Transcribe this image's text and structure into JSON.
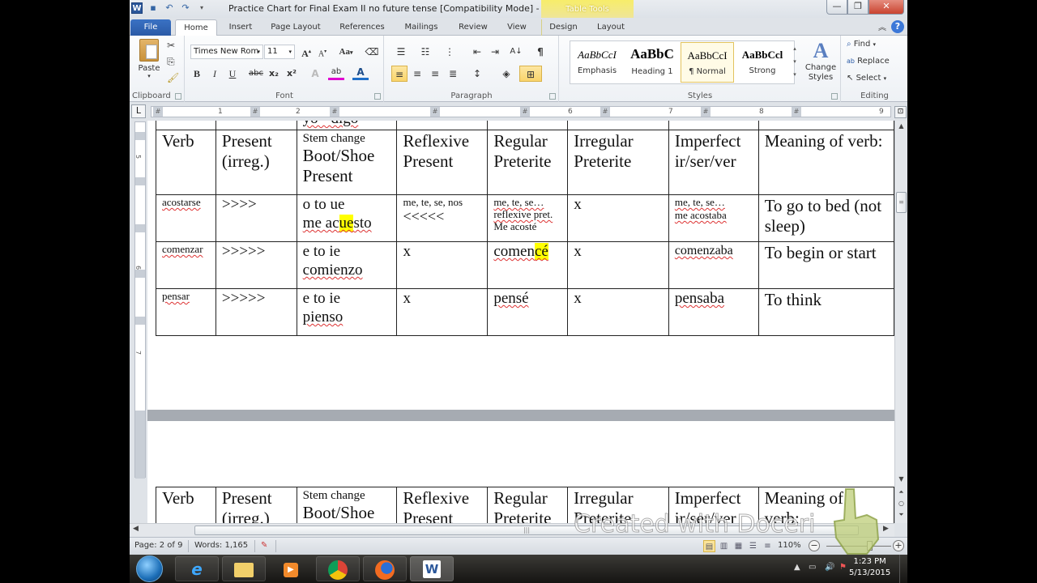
{
  "window": {
    "title": "Practice Chart for Final Exam II no future tense [Compatibility Mode]  -  Mi...",
    "contextual_tab_group": "Table Tools",
    "buttons": {
      "minimize": "—",
      "restore": "❐",
      "close": "✕"
    }
  },
  "quick_access": {
    "app_icon": "W",
    "save": "save-icon",
    "undo": "undo-icon",
    "redo": "redo-icon"
  },
  "tabs": [
    {
      "label": "File"
    },
    {
      "label": "Home",
      "active": true
    },
    {
      "label": "Insert"
    },
    {
      "label": "Page Layout"
    },
    {
      "label": "References"
    },
    {
      "label": "Mailings"
    },
    {
      "label": "Review"
    },
    {
      "label": "View"
    },
    {
      "label": "Design"
    },
    {
      "label": "Layout"
    }
  ],
  "ribbon": {
    "clipboard": {
      "label": "Clipboard",
      "paste": "Paste"
    },
    "font": {
      "label": "Font",
      "font_name": "Times New Rom",
      "font_size": "11",
      "bold": "B",
      "italic": "I",
      "underline": "U",
      "strike": "abc",
      "subscript": "x₂",
      "superscript": "x²",
      "grow": "A",
      "shrink": "A",
      "change_case": "Aa"
    },
    "paragraph": {
      "label": "Paragraph",
      "pilcrow": "¶"
    },
    "styles": {
      "label": "Styles",
      "items": [
        {
          "preview": "AaBbCcI",
          "name": "Emphasis"
        },
        {
          "preview": "AaBbC",
          "name": "Heading 1"
        },
        {
          "preview": "AaBbCcI",
          "name": "¶ Normal",
          "selected": true
        },
        {
          "preview": "AaBbCcl",
          "name": "Strong"
        }
      ],
      "change_styles": "Change Styles"
    },
    "editing": {
      "label": "Editing",
      "find": "Find",
      "replace": "Replace",
      "select": "Select"
    }
  },
  "ruler": {
    "numbers": [
      "1",
      "2",
      "3",
      "4",
      "5",
      "6",
      "7",
      "8",
      "9"
    ],
    "vertical_numbers": [
      "5",
      "6",
      "7"
    ]
  },
  "document": {
    "top_fragment": "yo - digo",
    "headers": [
      {
        "main": "Verb"
      },
      {
        "main": "Present (irreg.)"
      },
      {
        "small": "Stem change",
        "main": "Boot/Shoe Present"
      },
      {
        "main": "Reflexive Present"
      },
      {
        "main": "Regular Preterite"
      },
      {
        "main": "Irregular Preterite"
      },
      {
        "main": "Imperfect ir/ser/ver"
      },
      {
        "main": "Meaning of verb:"
      }
    ],
    "rows": [
      {
        "verb": "acostarse",
        "present_irreg": ">>>>",
        "stem_change": "o to ue",
        "stem_example_pre": "me ac",
        "stem_example_hl": "ue",
        "stem_example_post": "sto",
        "reflexive_line1": "me, te, se, nos",
        "reflexive_line2": "<<<<<",
        "reg_pret_line1": "me, te, se…",
        "reg_pret_line2": "reflexive pret.",
        "reg_pret_line3": "Me acosté",
        "irreg_pret": "x",
        "imperfect_line1": "me, te, se…",
        "imperfect_line2": "me acostaba",
        "meaning": "To go to bed (not sleep)"
      },
      {
        "verb": "comenzar",
        "present_irreg": ">>>>>",
        "stem_change": "e to ie",
        "stem_example": "comienzo",
        "reflexive": "x",
        "reg_pret_pre": "comen",
        "reg_pret_hl": "cé",
        "irreg_pret": "x",
        "imperfect": "comenzaba",
        "meaning": "To begin or start"
      },
      {
        "verb": "pensar",
        "present_irreg": ">>>>>",
        "stem_change": "e to ie",
        "stem_example": "pienso",
        "reflexive": "x",
        "reg_pret": "pensé",
        "irreg_pret": "x",
        "imperfect": "pensaba",
        "meaning": "To think"
      }
    ],
    "page2_headers_line1": [
      "Verb",
      "Present",
      "Stem change",
      "Reflexive",
      "Regular",
      "Irregular",
      "Imperfect",
      "Meaning of"
    ],
    "page2_headers_line2": [
      "",
      "(irreg.)",
      "Boot/Shoe",
      "Present",
      "Preterite",
      "Preterite",
      "ir/ser/ver",
      "verb:"
    ]
  },
  "status_bar": {
    "page": "Page: 2 of 9",
    "words": "Words: 1,165",
    "zoom": "110%"
  },
  "watermark": "Created with Doceri",
  "taskbar": {
    "apps": [
      "internet-explorer",
      "file-explorer",
      "media-player",
      "chrome",
      "firefox",
      "word"
    ],
    "clock_time": "1:23 PM",
    "clock_date": "5/13/2015"
  },
  "colors": {
    "highlight": "#ffff00",
    "file_tab": "#2a5aa6",
    "table_tools": "#f1e77a",
    "close_button": "#c9432f"
  }
}
